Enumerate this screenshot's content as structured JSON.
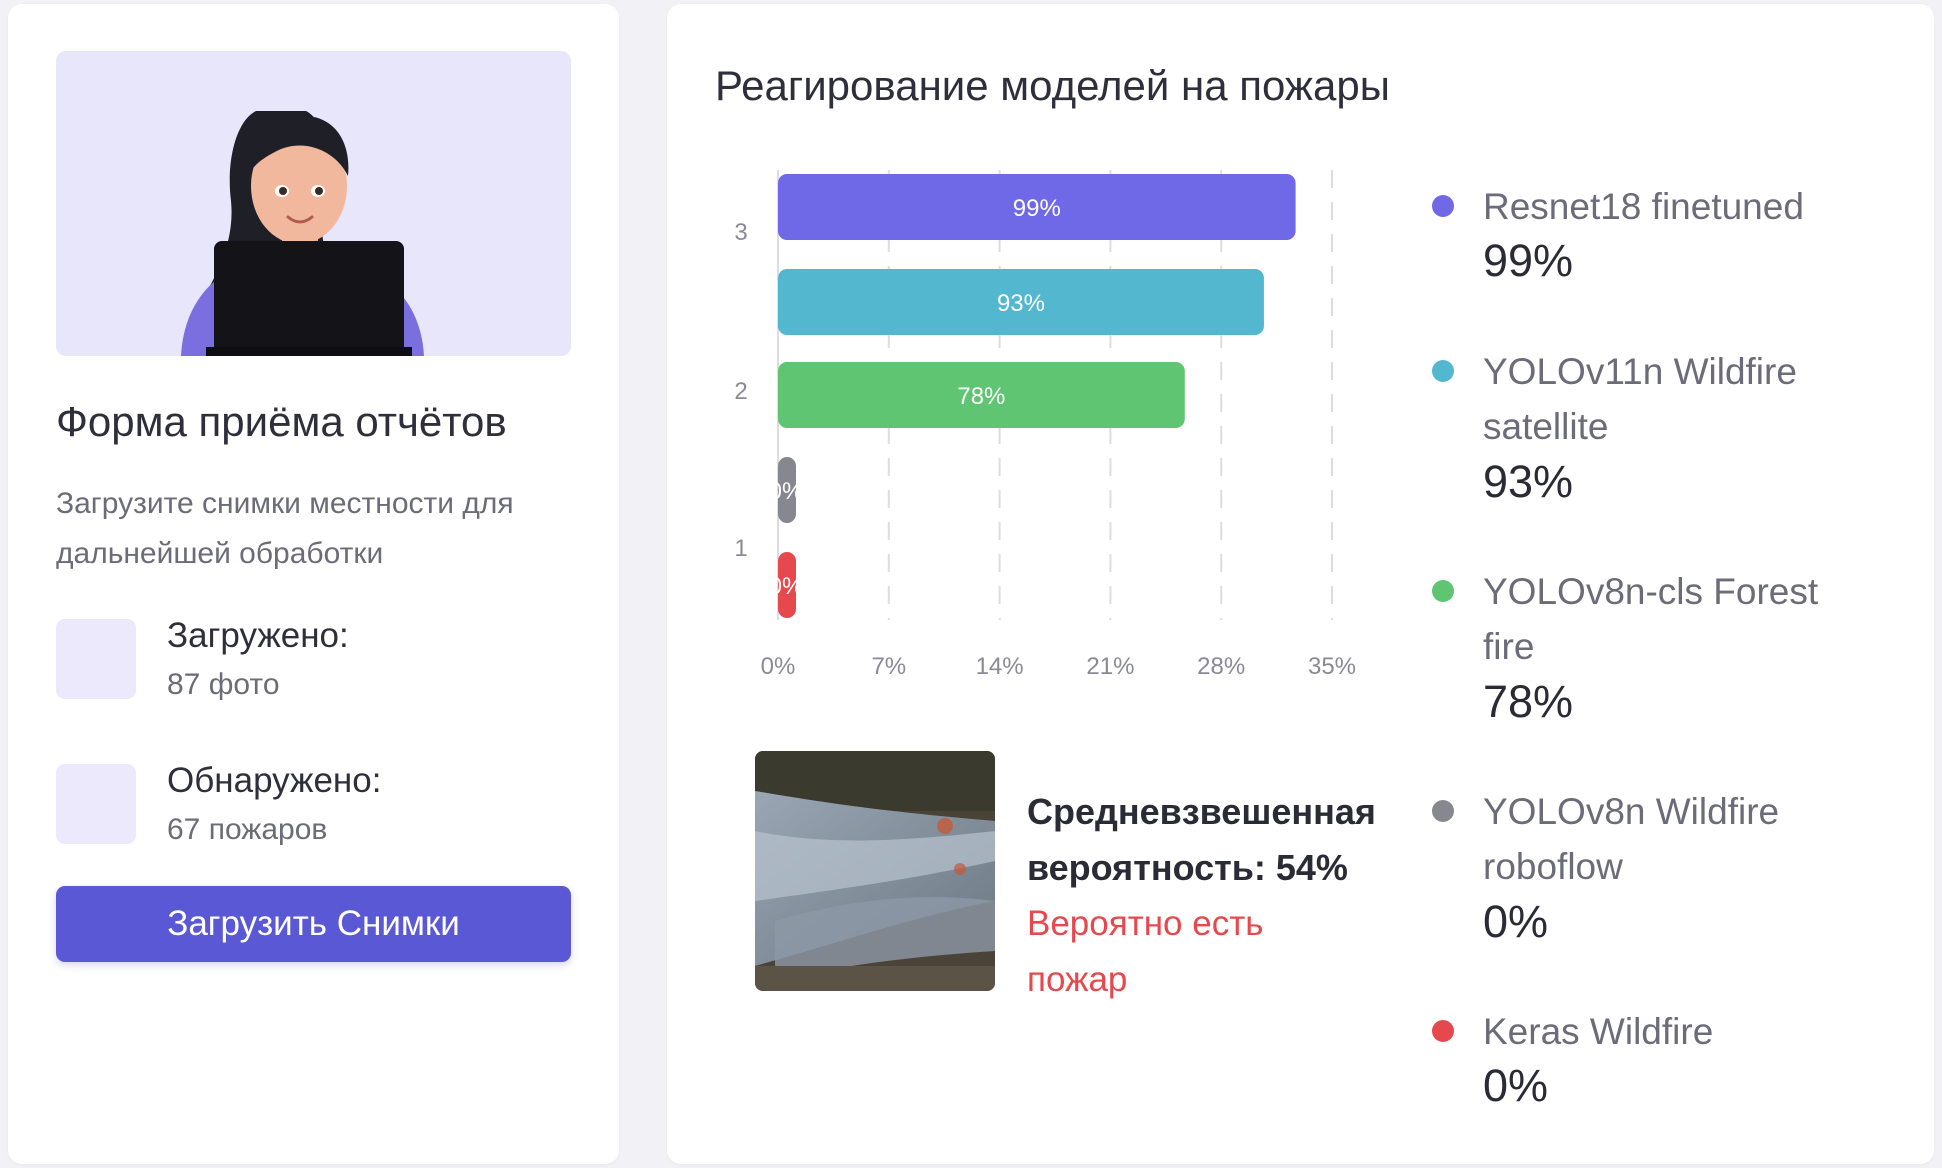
{
  "form": {
    "title": "Форма приёма отчётов",
    "subtitle": "Загрузите снимки местности для дальнейшей обработки",
    "uploaded_label": "Загружено:",
    "uploaded_value": "87 фото",
    "detected_label": "Обнаружено:",
    "detected_value": "67 пожаров",
    "upload_button": "Загрузить Снимки"
  },
  "chart_panel": {
    "title": "Реагирование моделей на пожары",
    "avg_label": "Средневзвешенная вероятность: 54%",
    "avg_status": "Вероятно есть пожар"
  },
  "chart_data": {
    "type": "bar",
    "orientation": "horizontal",
    "x_ticks": [
      "0%",
      "7%",
      "14%",
      "21%",
      "28%",
      "35%"
    ],
    "y_ticks": [
      "3",
      "2",
      "1"
    ],
    "xlim": [
      0,
      35
    ],
    "grid": "vertical dashed",
    "legend_position": "right",
    "series": [
      {
        "name": "Resnet18 finetuned",
        "label": "99%",
        "legend_value": "99%",
        "bar_value": 32.7,
        "color": "#6f69e8"
      },
      {
        "name": "YOLOv11n Wildfire satellite",
        "label": "93%",
        "legend_value": "93%",
        "bar_value": 30.7,
        "color": "#52b7cf"
      },
      {
        "name": "YOLOv8n-cls Forest fire",
        "label": "78%",
        "legend_value": "78%",
        "bar_value": 25.7,
        "color": "#5fc572"
      },
      {
        "name": "YOLOv8n Wildfire roboflow",
        "label": "0%",
        "legend_value": "0%",
        "bar_value": 0,
        "color": "#87878f"
      },
      {
        "name": "Keras Wildfire",
        "label": "0%",
        "legend_value": "0%",
        "bar_value": 0,
        "color": "#e5484d"
      }
    ]
  },
  "colors": {
    "accent": "#5b58d6",
    "danger": "#e5484d",
    "hero_bg": "#e8e6fb"
  },
  "icons": {
    "hero": "woman-with-laptop-illustration",
    "thumbnail": "satellite-fire-image"
  }
}
